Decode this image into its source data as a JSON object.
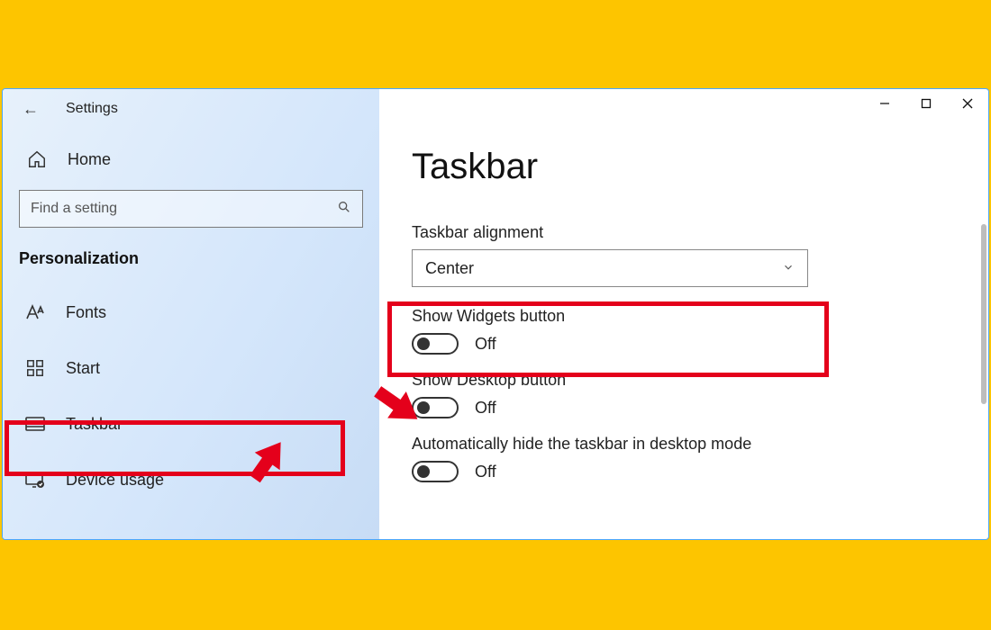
{
  "app_title": "Settings",
  "search": {
    "placeholder": "Find a setting"
  },
  "sidebar": {
    "home": "Home",
    "section": "Personalization",
    "items": [
      {
        "label": "Fonts"
      },
      {
        "label": "Start"
      },
      {
        "label": "Taskbar"
      },
      {
        "label": "Device usage"
      }
    ]
  },
  "page": {
    "heading": "Taskbar",
    "alignment_label": "Taskbar alignment",
    "alignment_value": "Center",
    "settings": [
      {
        "label": "Show Widgets button",
        "state": "Off"
      },
      {
        "label": "Show Desktop button",
        "state": "Off"
      },
      {
        "label": "Automatically hide the taskbar in desktop mode",
        "state": "Off"
      }
    ]
  }
}
